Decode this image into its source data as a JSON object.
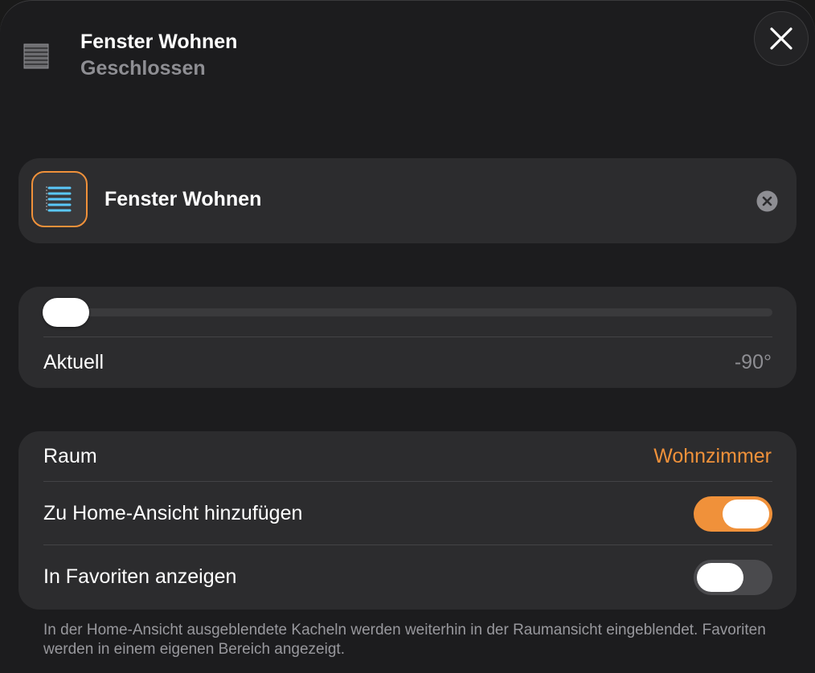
{
  "header": {
    "title": "Fenster Wohnen",
    "status": "Geschlossen",
    "icon": "window-blinds-icon"
  },
  "close_button": {
    "icon": "close-icon"
  },
  "name_card": {
    "icon": "window-blinds-icon",
    "name_value": "Fenster Wohnen",
    "clear_icon": "clear-icon"
  },
  "slider_card": {
    "label": "Aktuell",
    "value": "-90°",
    "position_fraction": 0.0
  },
  "settings": {
    "room_label": "Raum",
    "room_value": "Wohnzimmer",
    "home_view_label": "Zu Home-Ansicht hinzufügen",
    "home_view_on": true,
    "favorites_label": "In Favoriten anzeigen",
    "favorites_on": false
  },
  "footnote": "In der Home-Ansicht ausgeblendete Kacheln werden weiterhin in der Raumansicht eingeblendet. Favoriten werden in einem eigenen Bereich angezeigt.",
  "colors": {
    "accent": "#f0913a",
    "background": "#1c1c1e",
    "card": "#2c2c2e",
    "secondary_text": "#8e8e93",
    "icon_blue": "#5ac8fa"
  }
}
